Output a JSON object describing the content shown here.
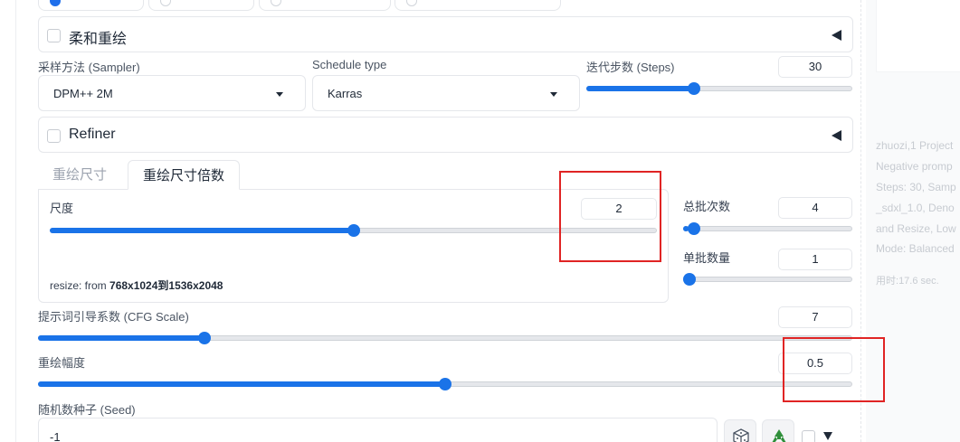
{
  "soft_inpaint": {
    "label": "柔和重绘",
    "checked": false
  },
  "sampler": {
    "label": "采样方法 (Sampler)",
    "value": "DPM++ 2M"
  },
  "schedule": {
    "label": "Schedule type",
    "value": "Karras"
  },
  "steps": {
    "label": "迭代步数 (Steps)",
    "value": "30",
    "level": 0.4
  },
  "refiner": {
    "label": "Refiner",
    "checked": false
  },
  "tabs": [
    {
      "label": "重绘尺寸",
      "active": false
    },
    {
      "label": "重绘尺寸倍数",
      "active": true
    }
  ],
  "scale": {
    "label": "尺度",
    "value": "2",
    "level": 0.5
  },
  "resize": {
    "prefix": "resize: from ",
    "info": "768x1024到1536x2048"
  },
  "batch_count": {
    "label": "总批次数",
    "value": "4",
    "level": 0.03
  },
  "batch_size": {
    "label": "单批数量",
    "value": "1",
    "level": 0.0
  },
  "cfg": {
    "label": "提示词引导系数 (CFG Scale)",
    "value": "7",
    "level": 0.2
  },
  "denoise": {
    "label": "重绘幅度",
    "value": "0.5",
    "level": 0.5
  },
  "seed": {
    "label": "随机数种子 (Seed)",
    "value": "-1"
  },
  "info_lines": [
    "zhuozi,1 Project",
    "Negative promp",
    "Steps: 30, Samp",
    "_sdxl_1.0, Deno",
    "and Resize, Low",
    "Mode: Balanced"
  ],
  "time": {
    "prefix": "用时:",
    "value": "17.6 sec."
  },
  "colors": {
    "accent": "#1a73e8",
    "highlight": "#e02424"
  },
  "icons": {
    "dice": "dice-icon",
    "recycle": "recycle-icon"
  }
}
